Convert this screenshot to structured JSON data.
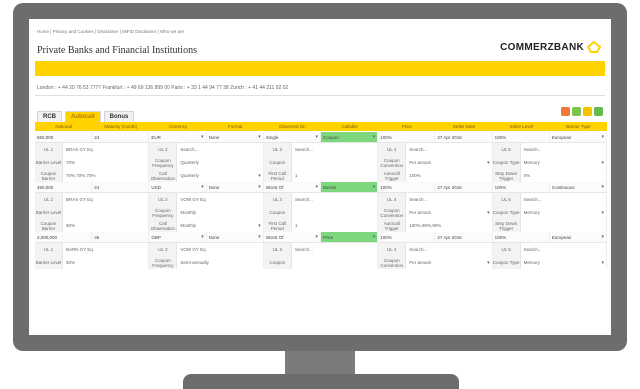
{
  "nav": {
    "links": "Home | Privacy and Cookies | Disclaimer | MiFID Disclaimer | Who we are"
  },
  "header": {
    "title": "Private Banks and Financial Institutions",
    "brand": "COMMERZBANK",
    "contacts": "London : + 44 20 76 53 7777    Frankfurt : + 49 69 136 899 00    Paris : + 33 1 44 94 77 38    Zurich : + 41 44 211 92 02"
  },
  "tabs": [
    {
      "label": "RCB"
    },
    {
      "label": "Autocall"
    },
    {
      "label": "Bonus"
    }
  ],
  "columns": [
    "Notional",
    "Maturity (month)",
    "Currency",
    "Format",
    "Observed On",
    "Callable",
    "Price",
    "Strike Date",
    "Strike Level",
    "Barrier Type"
  ],
  "rows": [
    {
      "main": [
        "650,000",
        "24",
        "EUR",
        "None",
        "Single",
        "Coupon",
        "100%",
        "27 Apr 2016",
        "100%",
        "European"
      ],
      "ul": [
        "UL 1",
        "BRAS GY Eq",
        "UL 2",
        "Search...",
        "UL 3",
        "Search...",
        "UL 4",
        "Search...",
        "UL 5",
        "Search..."
      ],
      "barrier": [
        "Barrier Level",
        "70%",
        "Coupon Frequency",
        "Quarterly",
        "Coupon",
        "",
        "Coupon Convention",
        "Per annum",
        "Coupon Type",
        "Memory"
      ],
      "coupon": [
        "Coupon Barrier",
        "70%,70%,70%",
        "Call Observation",
        "Quarterly",
        "First Call Period",
        "1",
        "Autocall Trigger",
        "100%",
        "Step Down Trigger",
        "0%"
      ]
    },
    {
      "main": [
        "450,000",
        "24",
        "USD",
        "None",
        "Worst Of",
        "Barrier",
        "100%",
        "27 Apr 2016",
        "100%",
        "Continuous"
      ],
      "ul": [
        "UL 1",
        "BRAS GY Eq",
        "UL 2",
        "VOW GY Eq",
        "UL 3",
        "Search...",
        "UL 4",
        "Search...",
        "UL 5",
        "Search..."
      ],
      "barrier": [
        "Barrier Level",
        "",
        "Coupon Frequency",
        "Monthly",
        "Coupon",
        "",
        "Coupon Convention",
        "Per annum",
        "Coupon Type",
        "Memory"
      ],
      "coupon": [
        "Coupon Barrier",
        "80%",
        "Call Observation",
        "Monthly",
        "First Call Period",
        "1",
        "Autocall Trigger",
        "100%,95%,90%",
        "Step Down Trigger",
        ""
      ]
    },
    {
      "main": [
        "2,000,000",
        "36",
        "GBP",
        "None",
        "Worst Of",
        "Price",
        "100%",
        "27 Apr 2016",
        "100%",
        "European"
      ],
      "ul": [
        "UL 1",
        "BARN GY Eq",
        "UL 2",
        "VOW GY Eq",
        "UL 3",
        "Search...",
        "UL 4",
        "Search...",
        "UL 5",
        "Search..."
      ],
      "barrier": [
        "Barrier Level",
        "50%",
        "Coupon Frequency",
        "Semi-annually",
        "Coupon",
        "",
        "Coupon Convention",
        "Per annum",
        "Coupon Type",
        "Memory"
      ]
    }
  ],
  "colors": {
    "accent": "#ffd200",
    "callable_highlight": "#7dd87d",
    "frame": "#6d6d6d"
  }
}
